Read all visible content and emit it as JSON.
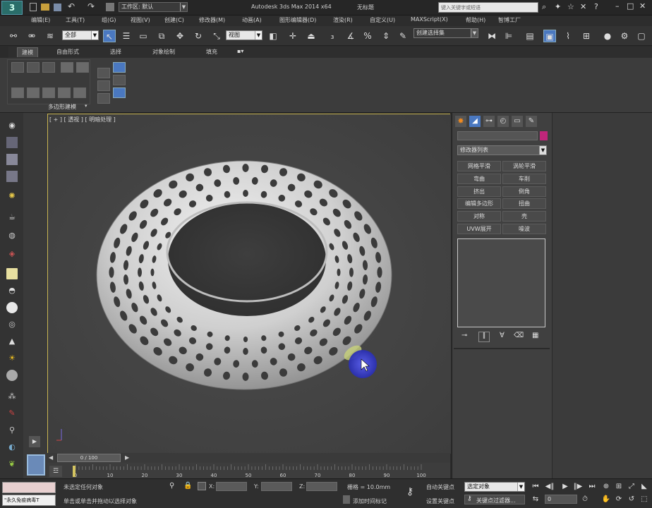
{
  "titlebar": {
    "workspace": "工作区: 默认",
    "title": "Autodesk 3ds Max  2014 x64",
    "doc": "无标题",
    "search_placeholder": "键入关键字或短语"
  },
  "menu": [
    {
      "label": "编辑(E)"
    },
    {
      "label": "工具(T)"
    },
    {
      "label": "组(G)"
    },
    {
      "label": "视图(V)"
    },
    {
      "label": "创建(C)"
    },
    {
      "label": "修改器(M)"
    },
    {
      "label": "动画(A)"
    },
    {
      "label": "图形编辑器(D)"
    },
    {
      "label": "渲染(R)"
    },
    {
      "label": "自定义(U)"
    },
    {
      "label": "MAXScript(X)"
    },
    {
      "label": "帮助(H)"
    },
    {
      "label": "智博工厂"
    }
  ],
  "toolbar": {
    "filter_value": "全部",
    "coord_value": "视图",
    "selset_value": "创建选择集"
  },
  "ribbon": {
    "tabs": [
      "建模",
      "自由形式",
      "选择",
      "对象绘制",
      "填充"
    ],
    "panel_label": "多边形建模"
  },
  "viewport": {
    "label": "[ + ] [ 透视 ] [ 明暗处理 ]"
  },
  "cmdpanel": {
    "modifier_list": "修改器列表",
    "buttons": [
      "网格平滑",
      "涡轮平滑",
      "弯曲",
      "车削",
      "挤出",
      "倒角",
      "编辑多边形",
      "扭曲",
      "对称",
      "壳",
      "UVW展开",
      "噪波"
    ]
  },
  "timeline": {
    "frame_label": "0 / 100",
    "ticks": [
      "0",
      "10",
      "20",
      "30",
      "40",
      "50",
      "60",
      "70",
      "80",
      "90",
      "100"
    ]
  },
  "status": {
    "script_text": "\"永久免疫病毒T",
    "sel_text": "未选定任何对象",
    "hint_text": "单击或单击并拖动以选择对象",
    "x_label": "X:",
    "y_label": "Y:",
    "z_label": "Z:",
    "grid_text": "栅格 = 10.0mm",
    "addtime_text": "添加时间标记",
    "autokey_label": "自动关键点",
    "setkey_label": "设置关键点",
    "select_value": "选定对象",
    "keyfilter_label": "关键点过滤器...",
    "frame_value": "0"
  },
  "colors": {
    "accent": "#4a78c0",
    "viewport_border": "#c8b451",
    "color_swatch": "#c0267a",
    "cursor_highlight": "#3a3fd0"
  }
}
